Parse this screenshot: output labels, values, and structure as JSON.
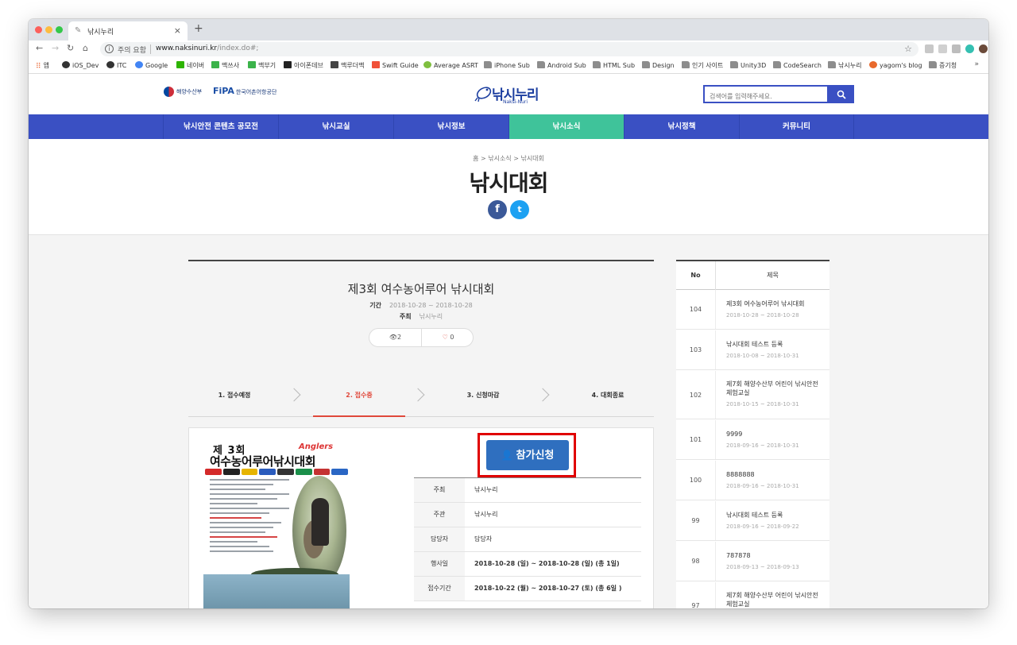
{
  "browser": {
    "tab_title": "낚시누리",
    "tab_close": "×",
    "new_tab": "+",
    "secure_label": "주의 요함",
    "url_host": "www.naksinuri.kr",
    "url_path": "/index.do#;",
    "bookmarks": [
      "앱",
      "iOS_Dev",
      "ITC",
      "Google",
      "네이버",
      "맥쓰사",
      "맥부기",
      "아이폰데브",
      "맥루더맥",
      "Swift Guide",
      "Average ASRT",
      "iPhone Sub",
      "Android Sub",
      "HTML Sub",
      "Design",
      "인기 사이트",
      "Unity3D",
      "CodeSearch",
      "낚시누리",
      "yagom's blog",
      "증기청"
    ],
    "bookmarks_more": "»"
  },
  "header": {
    "mof_label": "해양수산부",
    "fipa_label": "FiPA",
    "fipa_sub": "한국어촌어항공단",
    "logo_text": "낚시누리",
    "logo_sub": "Naksi-Nuri",
    "search_placeholder": "검색어를 입력해주세요."
  },
  "gnb": [
    "낚시안전 콘텐츠 공모전",
    "낚시교실",
    "낚시정보",
    "낚시소식",
    "낚시정책",
    "커뮤니티"
  ],
  "gnb_active_index": 3,
  "page": {
    "breadcrumb": "홈 > 낚시소식 > 낚시대회",
    "title": "낚시대회",
    "share_facebook": "f",
    "share_twitter": "t"
  },
  "event": {
    "title": "제3회 여수농어루어 낚시대회",
    "period_label": "기간",
    "period_value": "2018-10-28 ~ 2018-10-28",
    "host_label": "주최",
    "host_value": "낚시누리",
    "views": "2",
    "likes": "0",
    "steps": [
      "1. 접수예정",
      "2. 접수중",
      "3. 신청마감",
      "4. 대회종료"
    ],
    "active_step": 1,
    "apply_label": "참가신청",
    "poster_line1": "제 3회",
    "poster_line2": "여수농어루어낚시대회",
    "poster_anglers": "Anglers",
    "info": [
      {
        "label": "주최",
        "value": "낚시누리",
        "bold": false
      },
      {
        "label": "주관",
        "value": "낚시누리",
        "bold": false
      },
      {
        "label": "담당자",
        "value": "담당자",
        "bold": false
      },
      {
        "label": "행사일",
        "value": "2018-10-28 (일) ~ 2018-10-28 (일) (총 1일)",
        "bold": true
      },
      {
        "label": "접수기간",
        "value": "2018-10-22 (월) ~ 2018-10-27 (토) (총 6일 )",
        "bold": true
      }
    ]
  },
  "sidebar": {
    "col_no": "No",
    "col_title": "제목",
    "rows": [
      {
        "no": "104",
        "title": "제3회 여수농어루어 낚시대회",
        "date": "2018-10-28 ~ 2018-10-28"
      },
      {
        "no": "103",
        "title": "낚시대회 테스트 등록",
        "date": "2018-10-08 ~ 2018-10-31"
      },
      {
        "no": "102",
        "title": "제7회 해양수산부 어린이 낚시안전 체험교실",
        "date": "2018-10-15 ~ 2018-10-31"
      },
      {
        "no": "101",
        "title": "9999",
        "date": "2018-09-16 ~ 2018-10-31"
      },
      {
        "no": "100",
        "title": "8888888",
        "date": "2018-09-16 ~ 2018-10-31"
      },
      {
        "no": "99",
        "title": "낚시대회 테스트 등록",
        "date": "2018-09-16 ~ 2018-09-22"
      },
      {
        "no": "98",
        "title": "787878",
        "date": "2018-09-13 ~ 2018-09-13"
      },
      {
        "no": "97",
        "title": "제7회 해양수산부 어린이 낚시안전 체험교실",
        "date": ""
      }
    ]
  }
}
